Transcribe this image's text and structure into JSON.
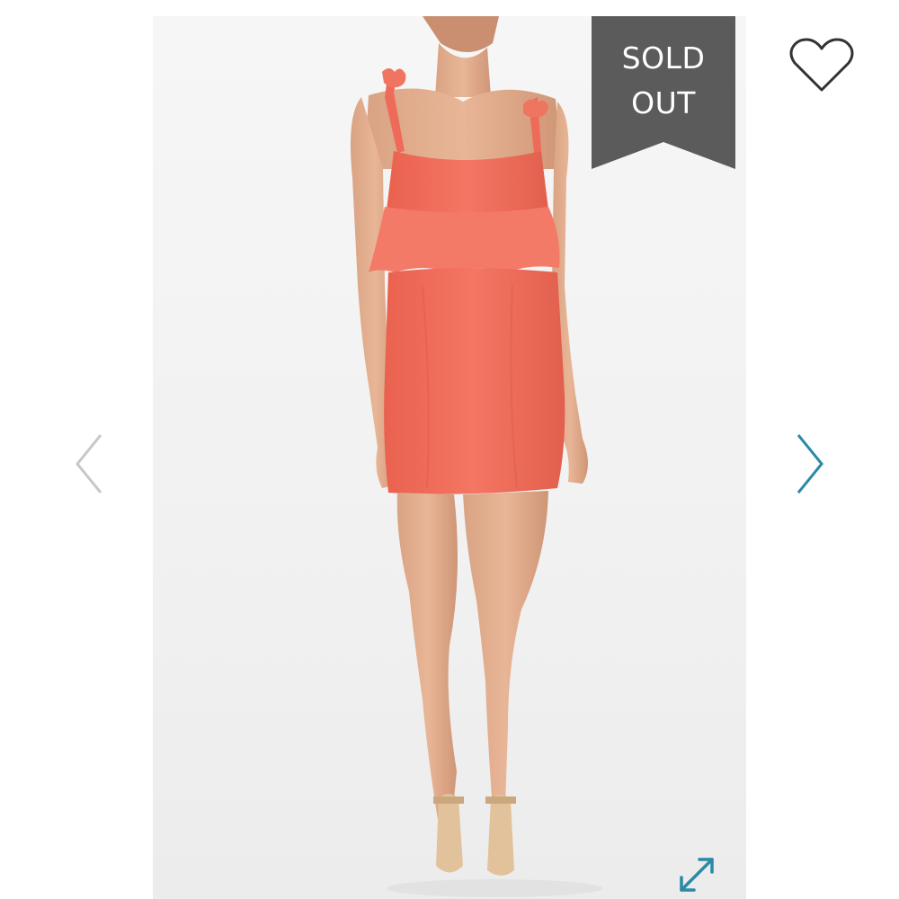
{
  "badge": {
    "line1": "SOLD",
    "line2": "OUT",
    "color": "#5b5b5b"
  },
  "product_image": {
    "background": "#f3f3f3",
    "dress_color": "#f0705e"
  },
  "controls": {
    "favorite_icon": "heart-outline-icon",
    "prev_icon": "chevron-left-icon",
    "next_icon": "chevron-right-icon",
    "expand_icon": "expand-arrows-icon",
    "accent_color": "#2b8aa6",
    "disabled_color": "#c8c8c8"
  }
}
